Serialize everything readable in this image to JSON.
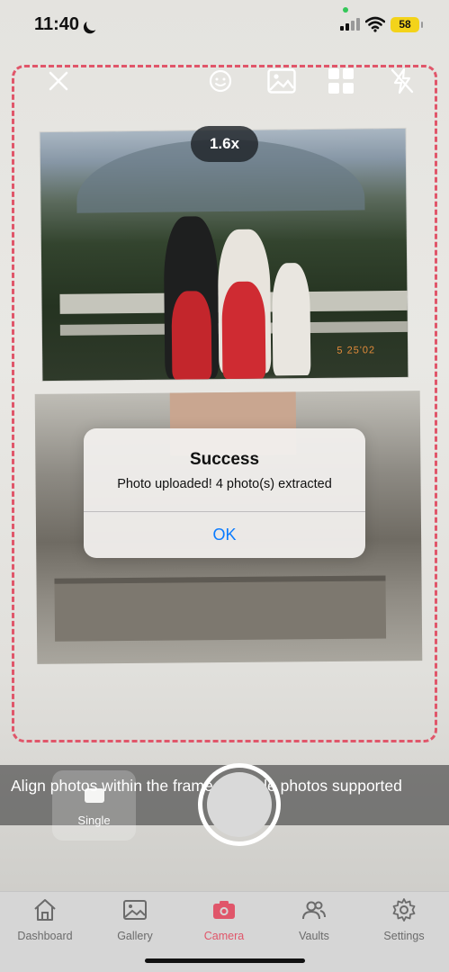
{
  "status_bar": {
    "time": "11:40",
    "battery": "58"
  },
  "camera": {
    "zoom": "1.6x",
    "photo_date_stamp": "5 25'02"
  },
  "alert": {
    "title": "Success",
    "message": "Photo uploaded! 4 photo(s) extracted",
    "ok_label": "OK"
  },
  "hint": {
    "text": "Align photos within the frame. Multiple photos supported"
  },
  "mode_button": {
    "label": "Single"
  },
  "tabs": [
    {
      "label": "Dashboard",
      "icon": "home-icon"
    },
    {
      "label": "Gallery",
      "icon": "image-icon"
    },
    {
      "label": "Camera",
      "icon": "camera-icon"
    },
    {
      "label": "Vaults",
      "icon": "users-icon"
    },
    {
      "label": "Settings",
      "icon": "gear-icon"
    }
  ],
  "colors": {
    "accent": "#e0566a",
    "alert_button": "#0a7bff",
    "battery": "#f3d31a"
  }
}
